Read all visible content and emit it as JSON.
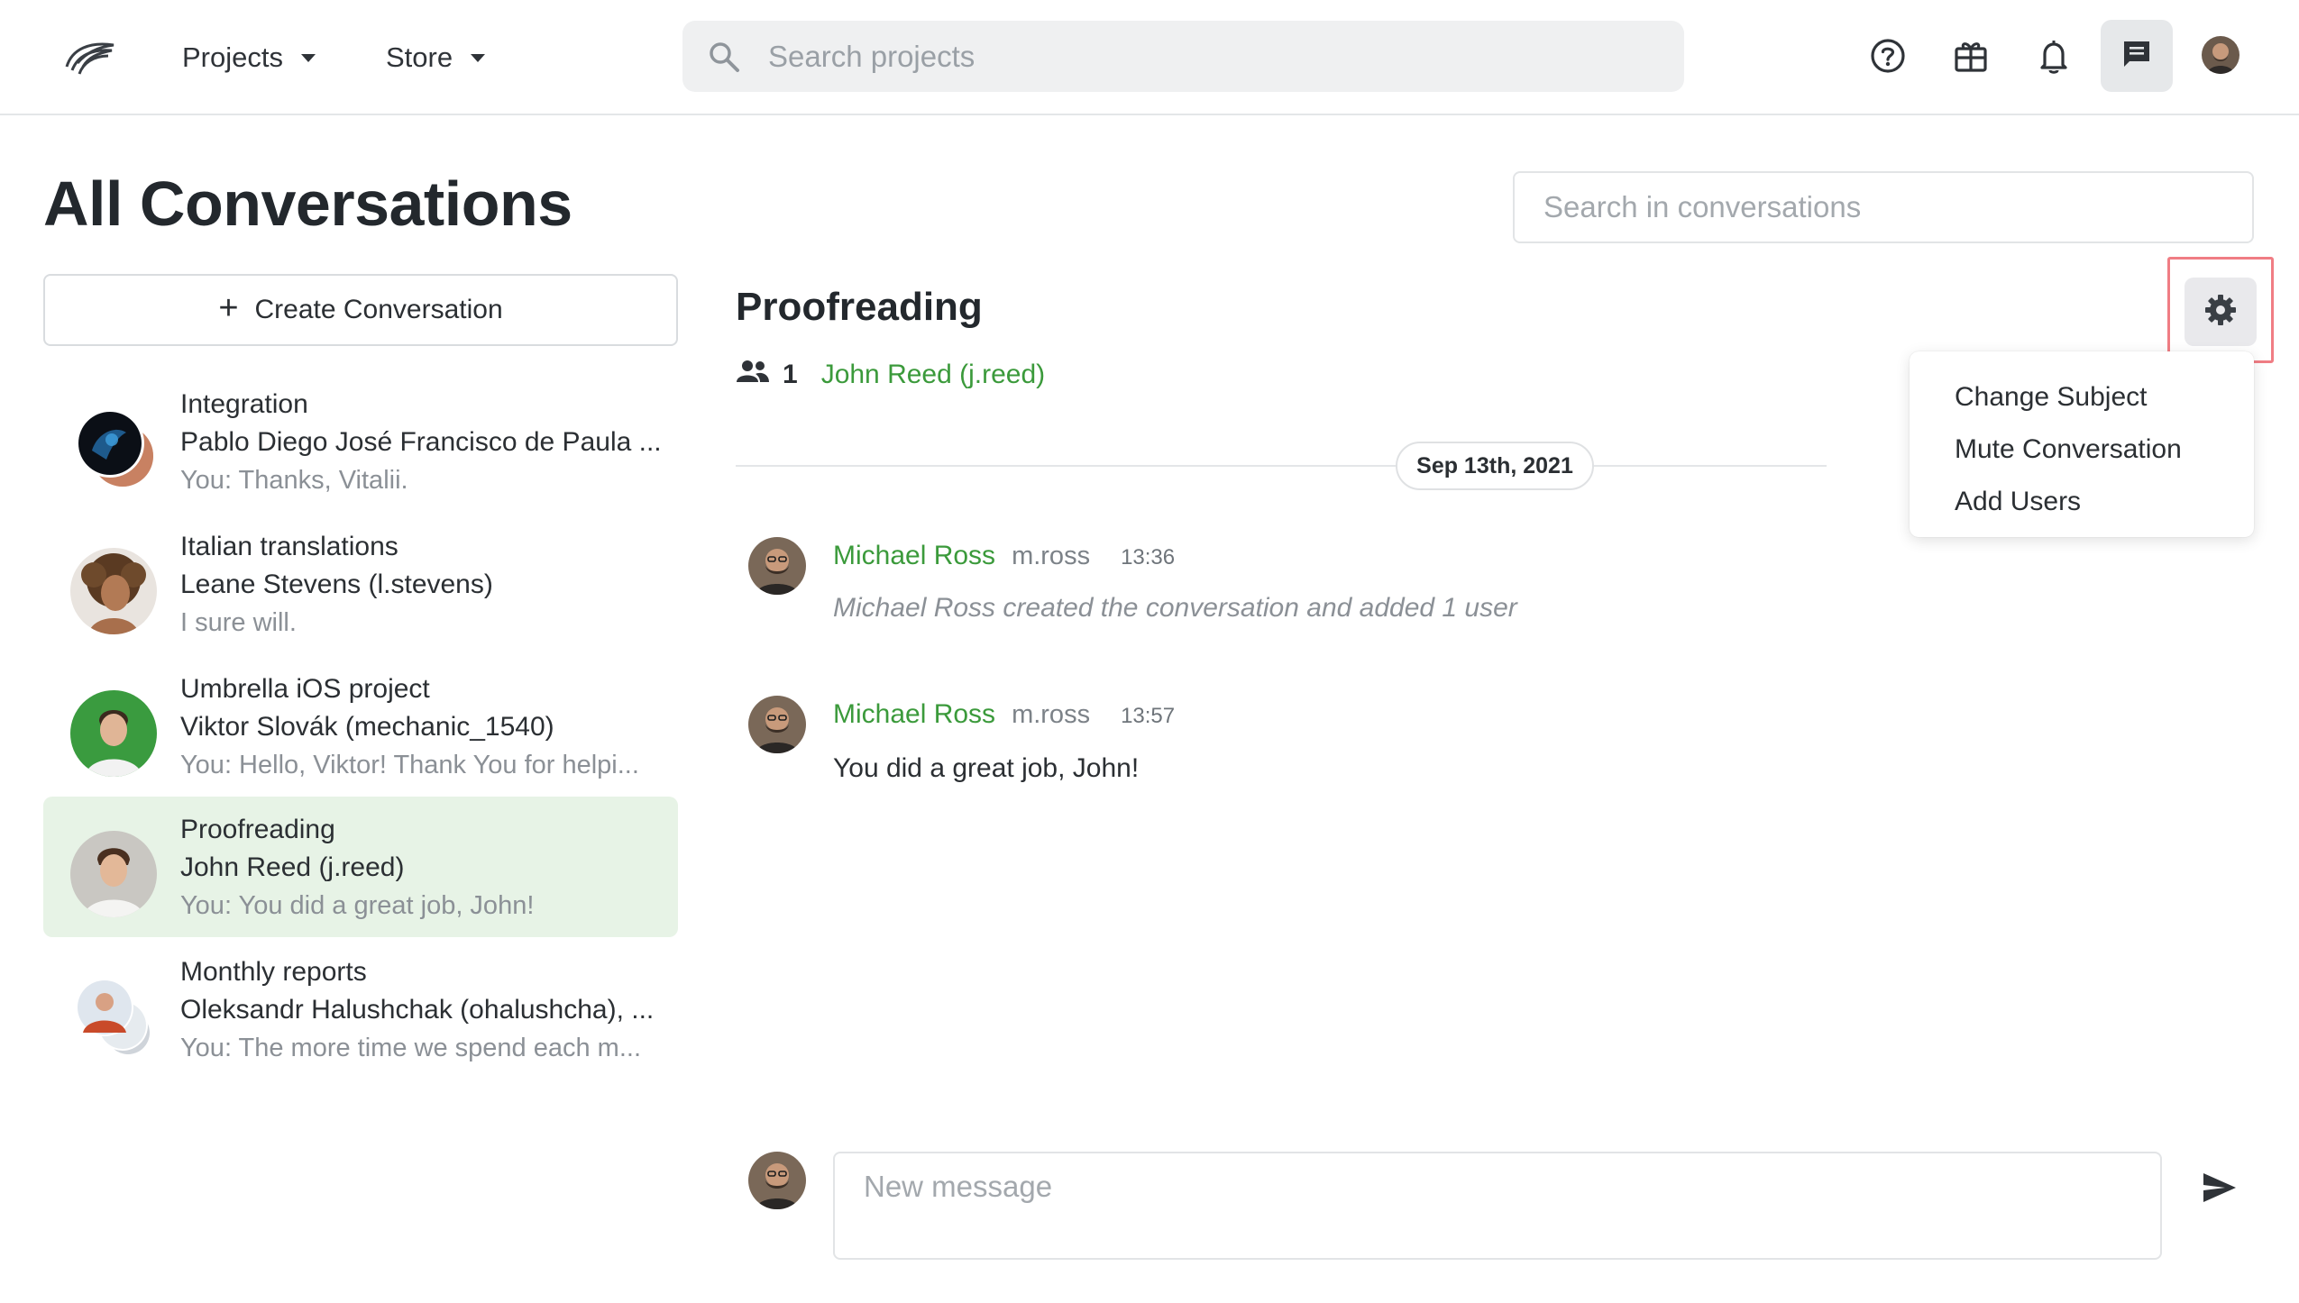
{
  "header": {
    "nav": [
      {
        "label": "Projects",
        "icon": "chevron-down-icon"
      },
      {
        "label": "Store",
        "icon": "chevron-down-icon"
      }
    ],
    "search_placeholder": "Search projects",
    "icons": [
      "help-icon",
      "gift-icon",
      "bell-icon",
      "chat-icon",
      "user-avatar"
    ]
  },
  "page": {
    "title": "All Conversations",
    "search_placeholder": "Search in conversations"
  },
  "sidebar": {
    "create_label": "Create Conversation",
    "conversations": [
      {
        "title": "Integration",
        "participants": "Pablo Diego José Francisco de Paula ...",
        "last": "You: Thanks, Vitalii."
      },
      {
        "title": "Italian translations",
        "participants": "Leane Stevens (l.stevens)",
        "last": "I sure will."
      },
      {
        "title": "Umbrella iOS project",
        "participants": "Viktor Slovák (mechanic_1540)",
        "last": "You: Hello, Viktor! Thank You for helpi..."
      },
      {
        "title": "Proofreading",
        "participants": "John Reed (j.reed)",
        "last": "You: You did a great job, John!",
        "active": true
      },
      {
        "title": "Monthly reports",
        "participants": "Oleksandr Halushchak (ohalushcha), ...",
        "last": "You: The more time we spend each m..."
      }
    ]
  },
  "conversation": {
    "title": "Proofreading",
    "participant_count": "1",
    "participant": "John Reed (j.reed)",
    "date": "Sep 13th, 2021",
    "settings_menu": [
      "Change Subject",
      "Mute Conversation",
      "Add Users"
    ],
    "messages": [
      {
        "author": "Michael Ross",
        "username": "m.ross",
        "time": "13:36",
        "text": "Michael Ross created the conversation and added 1 user",
        "system": true
      },
      {
        "author": "Michael Ross",
        "username": "m.ross",
        "time": "13:57",
        "text": "You did a great job, John!",
        "system": false
      }
    ],
    "composer_placeholder": "New message"
  },
  "colors": {
    "accent_green": "#3b9a3b",
    "active_bg": "#e7f3e6",
    "highlight_border": "#f07d84"
  }
}
